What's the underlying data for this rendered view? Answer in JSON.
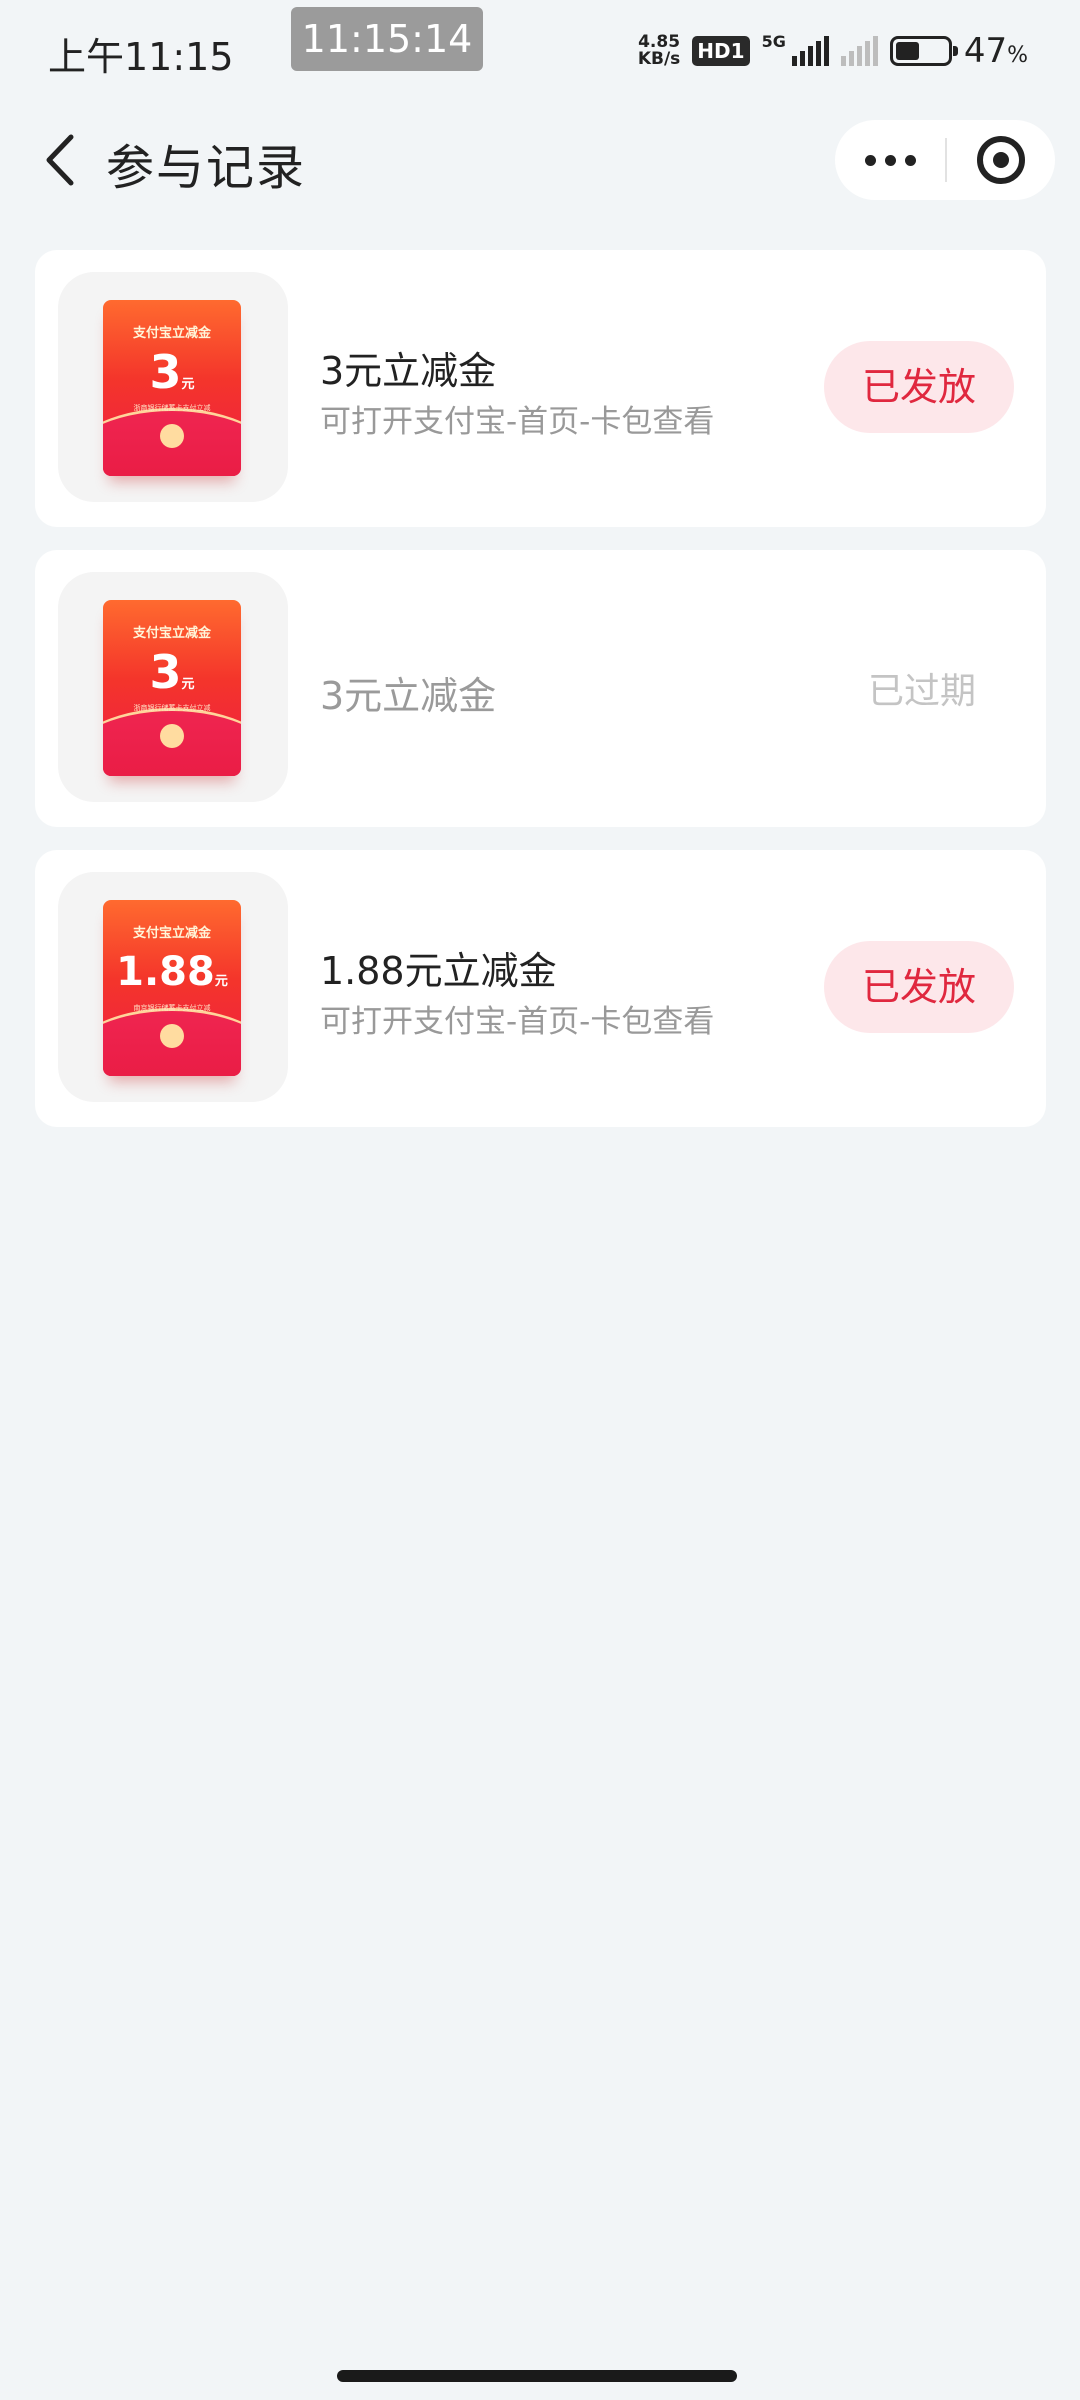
{
  "status_bar": {
    "time": "上午11:15",
    "clock_overlay": "11:15:14",
    "net_speed_value": "4.85",
    "net_speed_unit": "KB/s",
    "hd_badge": "HD1",
    "network_type": "5G",
    "battery_percent": "47",
    "battery_percent_sign": "%",
    "battery_level": 0.47
  },
  "header": {
    "title": "参与记录"
  },
  "records": [
    {
      "envelope_header": "支付宝立减金",
      "envelope_amount": "3",
      "envelope_unit": "元",
      "envelope_sub": "浙商银行储蓄卡支付立减",
      "title": "3元立减金",
      "subtitle": "可打开支付宝-首页-卡包查看",
      "status": "已发放"
    },
    {
      "envelope_header": "支付宝立减金",
      "envelope_amount": "3",
      "envelope_unit": "元",
      "envelope_sub": "浙商银行储蓄卡支付立减",
      "title": "3元立减金",
      "subtitle": "",
      "status": "已过期"
    },
    {
      "envelope_header": "支付宝立减金",
      "envelope_amount": "1.88",
      "envelope_unit": "元",
      "envelope_sub": "南京银行储蓄卡支付立减",
      "title": "1.88元立减金",
      "subtitle": "可打开支付宝-首页-卡包查看",
      "status": "已发放"
    }
  ]
}
